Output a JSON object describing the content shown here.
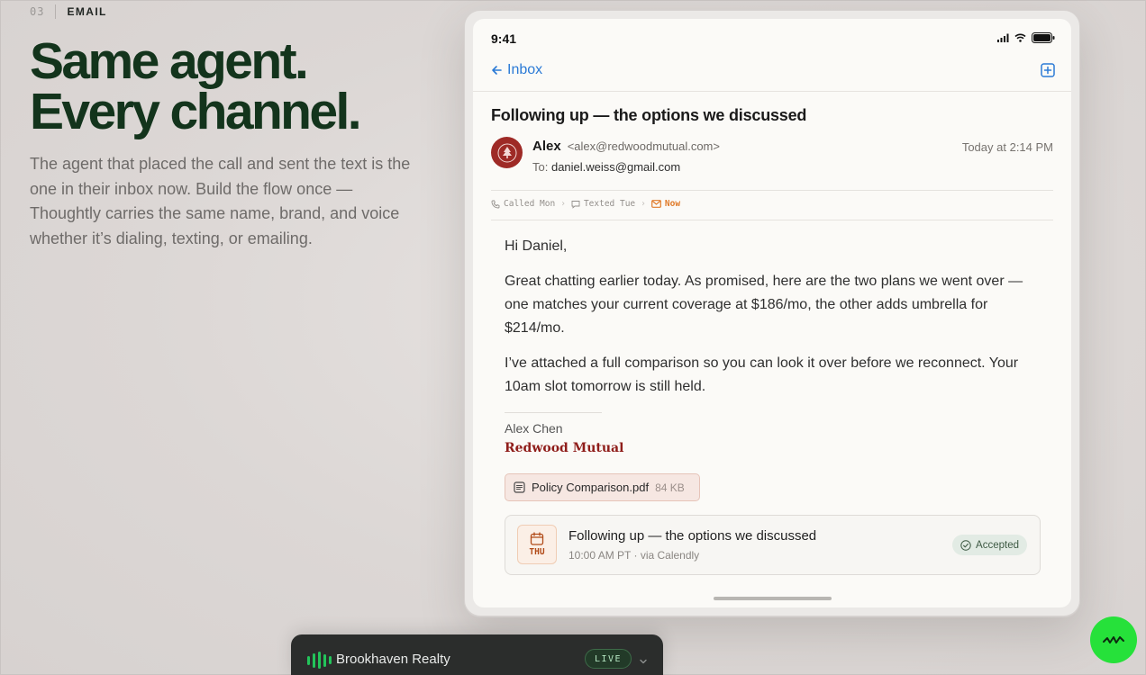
{
  "section": {
    "number": "03",
    "label": "EMAIL"
  },
  "headline": {
    "line1": "Same agent.",
    "line2": "Every channel."
  },
  "lede": "The agent that placed the call and sent the text is the one in their inbox now. Build the flow once — Thoughtly carries the same name, brand, and voice whether it’s dialing, texting, or emailing.",
  "phone": {
    "time": "9:41",
    "nav": {
      "back_label": "Inbox"
    },
    "email": {
      "subject": "Following up — the options we discussed",
      "sender_name": "Alex",
      "sender_email": "<alex@redwoodmutual.com>",
      "to_prefix": "To:",
      "to": "daniel.weiss@gmail.com",
      "timestamp": "Today at 2:14 PM",
      "timeline": {
        "called": "Called Mon",
        "texted": "Texted Tue",
        "now": "Now"
      },
      "greeting": "Hi Daniel,",
      "paragraph1": "Great chatting earlier today. As promised, here are the two plans we went over — one matches your current coverage at $186/mo, the other adds umbrella for $214/mo.",
      "paragraph2": "I’ve attached a full comparison so you can look it over before we reconnect. Your 10am slot tomorrow is still held.",
      "signature_name": "Alex Chen",
      "signature_company": "Redwood Mutual",
      "attachment": {
        "name": "Policy Comparison.pdf",
        "size": "84 KB"
      },
      "invite": {
        "day": "THU",
        "title": "Following up — the options we discussed",
        "meta": "10:00 AM PT · via Calendly",
        "status": "Accepted"
      }
    }
  },
  "callbar": {
    "name": "Brookhaven Realty",
    "status": "LIVE"
  },
  "colors": {
    "headline": "#13341c",
    "link": "#2b7ad6",
    "brand_red": "#9e2a26",
    "live_green": "#23c45a",
    "fab_green": "#26e13a"
  }
}
